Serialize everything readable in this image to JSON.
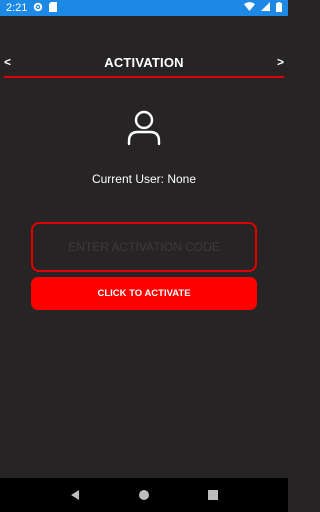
{
  "status_bar": {
    "time": "2:21",
    "icons": [
      "gear-icon",
      "sd-card-icon",
      "wifi-icon",
      "signal-icon",
      "battery-icon"
    ]
  },
  "header": {
    "title": "ACTIVATION",
    "left_arrow": "<",
    "right_arrow": ">"
  },
  "user": {
    "icon": "user-icon",
    "current_user_text": "Current User: None"
  },
  "activation": {
    "code_placeholder": "ENTER ACTIVATION CODE",
    "code_value": "",
    "button_label": "CLICK TO ACTIVATE"
  },
  "nav_bar": {
    "buttons": [
      "back-icon",
      "home-icon",
      "recents-icon"
    ]
  },
  "colors": {
    "background": "#272425",
    "status_bar": "#1e88e5",
    "accent_red": "#ff0000",
    "rule_red": "#e00000",
    "nav_bar": "#000000"
  }
}
